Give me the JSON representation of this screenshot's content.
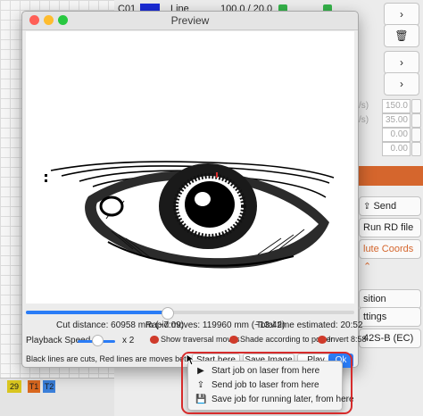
{
  "background": {
    "left_strip": {
      "cells": [
        "29",
        "T1",
        "T2"
      ],
      "colors": [
        "#d9c51f",
        "#d9681f",
        "#3b7fd9"
      ]
    },
    "top_bar": {
      "layer_name": "C01",
      "mode": "Line",
      "speed_power": "100.0 / 20.0"
    },
    "right_panel": {
      "fields": [
        {
          "label": "/s)",
          "value": "150.0"
        },
        {
          "label": "/s)",
          "value": "35.00"
        },
        {
          "label": "",
          "value": "0.00"
        },
        {
          "label": "",
          "value": "0.00"
        }
      ],
      "send_label": "Send",
      "run_rd_label": "Run RD file",
      "coords_label": "lute Coords",
      "position_label": "sition",
      "settings_label": "ttings",
      "device_label": "42S-B (EC)"
    }
  },
  "preview": {
    "title": "Preview",
    "progress_fraction": 0.43,
    "stats": {
      "cut_distance": "Cut distance: 60958 mm (~7:09)",
      "rapid_moves": "Rapid moves: 119960 mm (~13:42)",
      "total_time": "Total time estimated: 20:52"
    },
    "playback_speed_label": "Playback Speed",
    "playback_speed_value": "x 2",
    "options": {
      "show_traversal": "Show traversal moves",
      "shade_power": "Shade according to power",
      "invert": "Invert",
      "invert_value": "8:58"
    },
    "legend_note": "Black lines are cuts, Red lines are moves between cuts",
    "buttons": {
      "start_here": "Start here",
      "save_image": "Save Image",
      "play": "Play",
      "ok": "Ok"
    }
  },
  "start_menu": {
    "items": [
      {
        "icon": "play-icon",
        "label": "Start job on laser from here"
      },
      {
        "icon": "upload-icon",
        "label": "Send job to laser from here"
      },
      {
        "icon": "save-icon",
        "label": "Save job for running later, from here"
      }
    ]
  }
}
